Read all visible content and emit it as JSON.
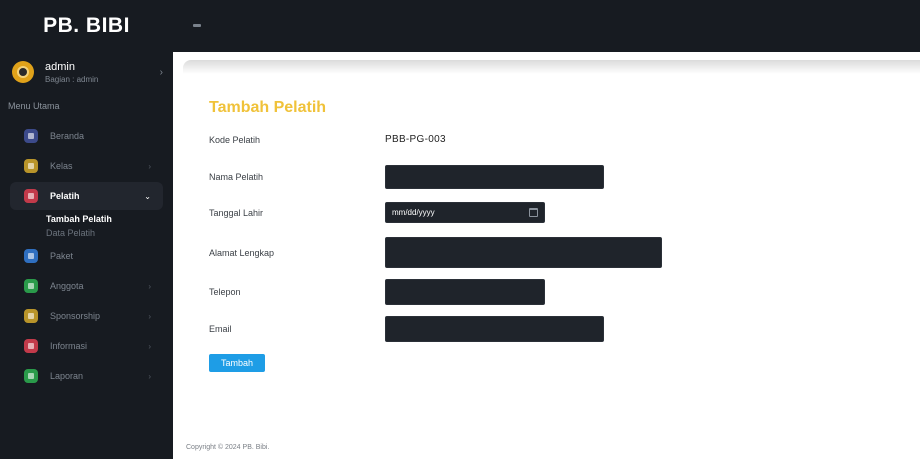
{
  "app": {
    "brand": "PB. BIBI"
  },
  "user": {
    "name": "admin",
    "role": "Bagian : admin"
  },
  "sidebar": {
    "menu_header": "Menu Utama",
    "items": [
      {
        "label": "Beranda",
        "icon": "home-icon",
        "color": "#3c4a8a"
      },
      {
        "label": "Kelas",
        "icon": "class-icon",
        "color": "#b8942a"
      },
      {
        "label": "Pelatih",
        "icon": "coach-icon",
        "color": "#c23a4a",
        "active": true,
        "children": [
          {
            "label": "Tambah Pelatih",
            "active": true
          },
          {
            "label": "Data Pelatih"
          }
        ]
      },
      {
        "label": "Paket",
        "icon": "package-icon",
        "color": "#2f6fc0"
      },
      {
        "label": "Anggota",
        "icon": "members-icon",
        "color": "#2a9a4a"
      },
      {
        "label": "Sponsorship",
        "icon": "sponsor-icon",
        "color": "#b8942a"
      },
      {
        "label": "Informasi",
        "icon": "info-icon",
        "color": "#c23a4a"
      },
      {
        "label": "Laporan",
        "icon": "report-icon",
        "color": "#2a9a4a"
      }
    ]
  },
  "form": {
    "title": "Tambah Pelatih",
    "fields": {
      "kode": {
        "label": "Kode Pelatih",
        "value": "PBB-PG-003"
      },
      "nama": {
        "label": "Nama Pelatih",
        "value": ""
      },
      "tanggal": {
        "label": "Tanggal Lahir",
        "placeholder": "mm/dd/yyyy"
      },
      "alamat": {
        "label": "Alamat Lengkap",
        "value": ""
      },
      "telepon": {
        "label": "Telepon",
        "value": ""
      },
      "email": {
        "label": "Email",
        "value": ""
      }
    },
    "submit_label": "Tambah"
  },
  "footer": {
    "text": "Copyright © 2024 PB. Bibi."
  },
  "colors": {
    "accent": "#f0c23a",
    "primary_button": "#1e9de6",
    "sidebar_bg": "#171b21",
    "field_bg": "#1f242b"
  }
}
